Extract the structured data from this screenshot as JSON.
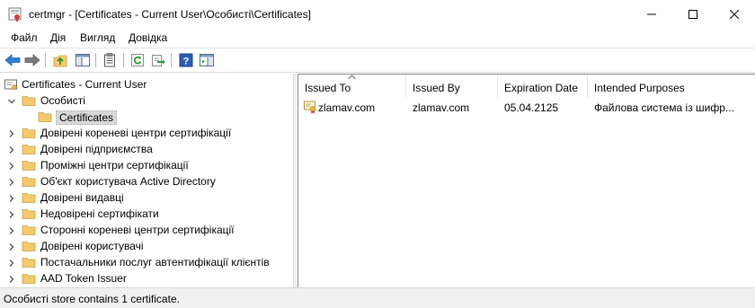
{
  "window": {
    "title": "certmgr - [Certificates - Current User\\Особисті\\Certificates]"
  },
  "menu": {
    "items": [
      "Файл",
      "Дія",
      "Вигляд",
      "Довідка"
    ]
  },
  "toolbar": {
    "buttons": [
      "back-icon",
      "forward-icon",
      "up-folder-icon",
      "show-hide-tree-icon",
      "properties-icon",
      "refresh-icon",
      "export-list-icon",
      "help-icon",
      "show-action-pane-icon"
    ]
  },
  "tree": {
    "root": "Certificates - Current User",
    "items": [
      {
        "label": "Особисті",
        "expanded": true
      },
      {
        "label": "Certificates",
        "selected": true
      },
      {
        "label": "Довірені кореневі центри сертифікації"
      },
      {
        "label": "Довірені підприємства"
      },
      {
        "label": "Проміжні центри сертифікації"
      },
      {
        "label": "Об'єкт користувача Active Directory"
      },
      {
        "label": "Довірені видавці"
      },
      {
        "label": "Недовірені сертифікати"
      },
      {
        "label": "Сторонні кореневі центри сертифікації"
      },
      {
        "label": "Довірені користувачі"
      },
      {
        "label": "Постачальники послуг автентифікації клієнтів"
      },
      {
        "label": "AAD Token Issuer"
      }
    ]
  },
  "list": {
    "columns": [
      "Issued To",
      "Issued By",
      "Expiration Date",
      "Intended Purposes"
    ],
    "rows": [
      {
        "issued_to": "zlamav.com",
        "issued_by": "zlamav.com",
        "expiration": "05.04.2125",
        "purposes": "Файлова система із шифр..."
      }
    ]
  },
  "status": {
    "text": "Особисті store contains 1 certificate."
  },
  "colors": {
    "folder": "#f3cb6b",
    "selection": "#d9d9d9",
    "accent": "#2b6cc4"
  }
}
